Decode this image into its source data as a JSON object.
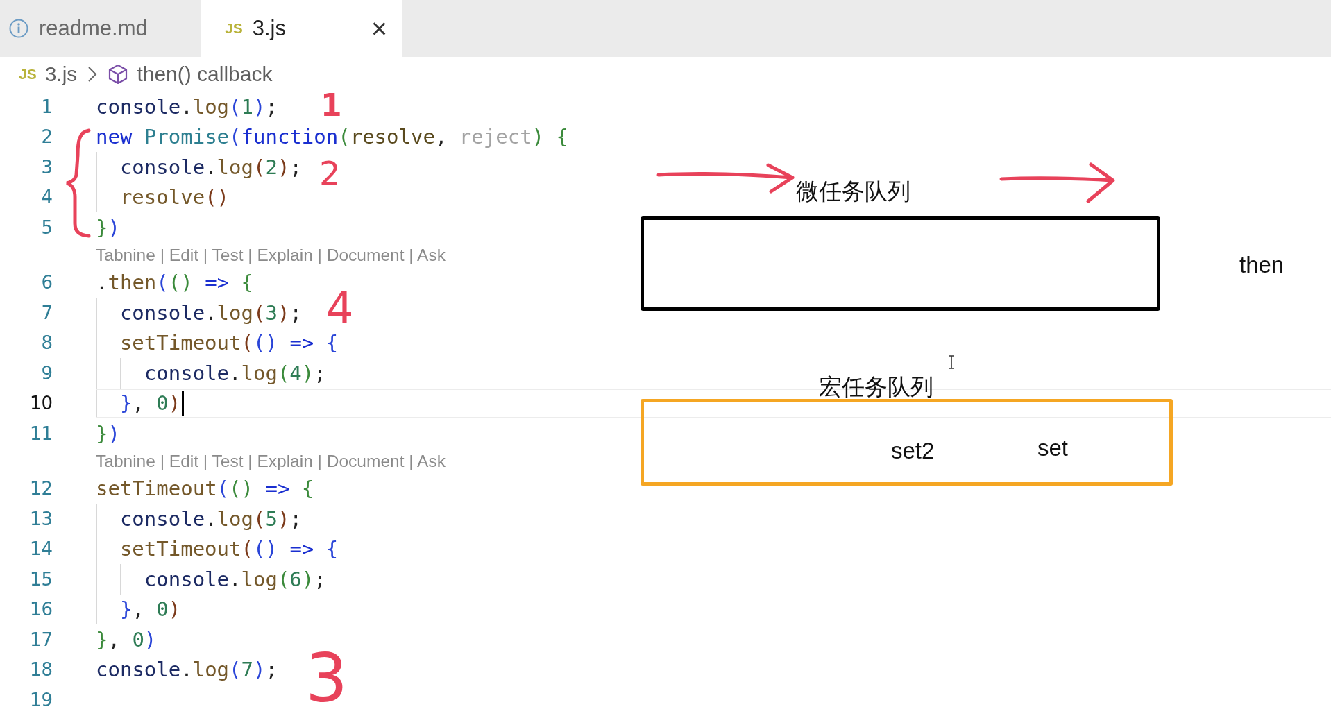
{
  "tabs": [
    {
      "kind": "doc",
      "label": "readme.md",
      "selected": false
    },
    {
      "kind": "script",
      "icon_text": "JS",
      "label": "3.js",
      "selected": true,
      "close": "×"
    }
  ],
  "breadcrumb": {
    "icon_text": "JS",
    "file": "3.js",
    "symbol": "then() callback"
  },
  "rows": [
    {
      "kind": "line",
      "number": "1",
      "current": false,
      "tokens": [
        {
          "text": "console",
          "color": "#1c2a63"
        },
        {
          "text": ".",
          "color": "#222222"
        },
        {
          "text": "log",
          "color": "#74582a"
        },
        {
          "text": "(",
          "color": "#2a45d8"
        },
        {
          "text": "1",
          "color": "#2e7c55"
        },
        {
          "text": ")",
          "color": "#2a45d8"
        },
        {
          "text": ";",
          "color": "#222222"
        }
      ]
    },
    {
      "kind": "line",
      "number": "2",
      "current": false,
      "tokens": [
        {
          "text": "new ",
          "color": "#1a2fd0"
        },
        {
          "text": "Promise",
          "color": "#2d7f90"
        },
        {
          "text": "(",
          "color": "#2a45d8"
        },
        {
          "text": "function",
          "color": "#1a2fd0"
        },
        {
          "text": "(",
          "color": "#3b8a3b"
        },
        {
          "text": "resolve",
          "color": "#5a4a1e"
        },
        {
          "text": ", ",
          "color": "#222222"
        },
        {
          "text": "reject",
          "color": "#a3a3a3"
        },
        {
          "text": ") ",
          "color": "#3b8a3b"
        },
        {
          "text": "{",
          "color": "#3b8a3b"
        }
      ],
      "children": [
        {
          "kind": "line",
          "number": "3",
          "current": false,
          "tokens": [
            {
              "text": "console",
              "color": "#1c2a63"
            },
            {
              "text": ".",
              "color": "#222222"
            },
            {
              "text": "log",
              "color": "#74582a"
            },
            {
              "text": "(",
              "color": "#7b3a1a"
            },
            {
              "text": "2",
              "color": "#2e7c55"
            },
            {
              "text": ")",
              "color": "#7b3a1a"
            },
            {
              "text": ";",
              "color": "#222222"
            }
          ]
        },
        {
          "kind": "line",
          "number": "4",
          "current": false,
          "tokens": [
            {
              "text": "resolve",
              "color": "#74582a"
            },
            {
              "text": "()",
              "color": "#7b3a1a"
            }
          ]
        }
      ]
    },
    {
      "kind": "line",
      "number": "5",
      "current": false,
      "tokens": [
        {
          "text": "}",
          "color": "#3b8a3b"
        },
        {
          "text": ")",
          "color": "#2a45d8"
        }
      ]
    },
    {
      "kind": "codelens",
      "text": "Tabnine | Edit | Test | Explain | Document | Ask"
    },
    {
      "kind": "line",
      "number": "6",
      "current": false,
      "tokens": [
        {
          "text": ".",
          "color": "#222222"
        },
        {
          "text": "then",
          "color": "#74582a"
        },
        {
          "text": "(",
          "color": "#2a45d8"
        },
        {
          "text": "() ",
          "color": "#3b8a3b"
        },
        {
          "text": "=> ",
          "color": "#1a2fd0"
        },
        {
          "text": "{",
          "color": "#3b8a3b"
        }
      ],
      "children": [
        {
          "kind": "line",
          "number": "7",
          "current": false,
          "tokens": [
            {
              "text": "console",
              "color": "#1c2a63"
            },
            {
              "text": ".",
              "color": "#222222"
            },
            {
              "text": "log",
              "color": "#74582a"
            },
            {
              "text": "(",
              "color": "#7b3a1a"
            },
            {
              "text": "3",
              "color": "#2e7c55"
            },
            {
              "text": ")",
              "color": "#7b3a1a"
            },
            {
              "text": ";",
              "color": "#222222"
            }
          ]
        },
        {
          "kind": "line",
          "number": "8",
          "current": false,
          "tokens": [
            {
              "text": "setTimeout",
              "color": "#74582a"
            },
            {
              "text": "(",
              "color": "#7b3a1a"
            },
            {
              "text": "() ",
              "color": "#2a45d8"
            },
            {
              "text": "=> ",
              "color": "#1a2fd0"
            },
            {
              "text": "{",
              "color": "#2a45d8"
            }
          ],
          "children": [
            {
              "kind": "line",
              "number": "9",
              "current": false,
              "tokens": [
                {
                  "text": "console",
                  "color": "#1c2a63"
                },
                {
                  "text": ".",
                  "color": "#222222"
                },
                {
                  "text": "log",
                  "color": "#74582a"
                },
                {
                  "text": "(",
                  "color": "#3b8a3b"
                },
                {
                  "text": "4",
                  "color": "#2e7c55"
                },
                {
                  "text": ")",
                  "color": "#3b8a3b"
                },
                {
                  "text": ";",
                  "color": "#222222"
                }
              ]
            }
          ]
        },
        {
          "kind": "line",
          "number": "10",
          "current": true,
          "tokens": [
            {
              "text": "}",
              "color": "#2a45d8"
            },
            {
              "text": ", ",
              "color": "#222222"
            },
            {
              "text": "0",
              "color": "#2e7c55"
            },
            {
              "text": ")",
              "color": "#7b3a1a"
            }
          ]
        }
      ]
    },
    {
      "kind": "line",
      "number": "11",
      "current": false,
      "tokens": [
        {
          "text": "}",
          "color": "#3b8a3b"
        },
        {
          "text": ")",
          "color": "#2a45d8"
        }
      ]
    },
    {
      "kind": "codelens",
      "text": "Tabnine | Edit | Test | Explain | Document | Ask"
    },
    {
      "kind": "line",
      "number": "12",
      "current": false,
      "tokens": [
        {
          "text": "setTimeout",
          "color": "#74582a"
        },
        {
          "text": "(",
          "color": "#2a45d8"
        },
        {
          "text": "() ",
          "color": "#3b8a3b"
        },
        {
          "text": "=> ",
          "color": "#1a2fd0"
        },
        {
          "text": "{",
          "color": "#3b8a3b"
        }
      ],
      "children": [
        {
          "kind": "line",
          "number": "13",
          "current": false,
          "tokens": [
            {
              "text": "console",
              "color": "#1c2a63"
            },
            {
              "text": ".",
              "color": "#222222"
            },
            {
              "text": "log",
              "color": "#74582a"
            },
            {
              "text": "(",
              "color": "#7b3a1a"
            },
            {
              "text": "5",
              "color": "#2e7c55"
            },
            {
              "text": ")",
              "color": "#7b3a1a"
            },
            {
              "text": ";",
              "color": "#222222"
            }
          ]
        },
        {
          "kind": "line",
          "number": "14",
          "current": false,
          "tokens": [
            {
              "text": "setTimeout",
              "color": "#74582a"
            },
            {
              "text": "(",
              "color": "#7b3a1a"
            },
            {
              "text": "() ",
              "color": "#2a45d8"
            },
            {
              "text": "=> ",
              "color": "#1a2fd0"
            },
            {
              "text": "{",
              "color": "#2a45d8"
            }
          ],
          "children": [
            {
              "kind": "line",
              "number": "15",
              "current": false,
              "tokens": [
                {
                  "text": "console",
                  "color": "#1c2a63"
                },
                {
                  "text": ".",
                  "color": "#222222"
                },
                {
                  "text": "log",
                  "color": "#74582a"
                },
                {
                  "text": "(",
                  "color": "#3b8a3b"
                },
                {
                  "text": "6",
                  "color": "#2e7c55"
                },
                {
                  "text": ")",
                  "color": "#3b8a3b"
                },
                {
                  "text": ";",
                  "color": "#222222"
                }
              ]
            }
          ]
        },
        {
          "kind": "line",
          "number": "16",
          "current": false,
          "tokens": [
            {
              "text": "}",
              "color": "#2a45d8"
            },
            {
              "text": ", ",
              "color": "#222222"
            },
            {
              "text": "0",
              "color": "#2e7c55"
            },
            {
              "text": ")",
              "color": "#7b3a1a"
            }
          ]
        }
      ]
    },
    {
      "kind": "line",
      "number": "17",
      "current": false,
      "tokens": [
        {
          "text": "}",
          "color": "#3b8a3b"
        },
        {
          "text": ", ",
          "color": "#222222"
        },
        {
          "text": "0",
          "color": "#2e7c55"
        },
        {
          "text": ")",
          "color": "#2a45d8"
        }
      ]
    },
    {
      "kind": "line",
      "number": "18",
      "current": false,
      "tokens": [
        {
          "text": "console",
          "color": "#1c2a63"
        },
        {
          "text": ".",
          "color": "#222222"
        },
        {
          "text": "log",
          "color": "#74582a"
        },
        {
          "text": "(",
          "color": "#2a45d8"
        },
        {
          "text": "7",
          "color": "#2e7c55"
        },
        {
          "text": ")",
          "color": "#2a45d8"
        },
        {
          "text": ";",
          "color": "#222222"
        }
      ]
    },
    {
      "kind": "line",
      "number": "19",
      "current": false
    }
  ],
  "diagram": {
    "queues": [
      {
        "label": "微任务队列",
        "color": "#000000"
      },
      {
        "label": "宏任务队列",
        "color": "#f5a623",
        "items": [
          "set2",
          "set"
        ]
      }
    ],
    "notes": [
      "then"
    ],
    "handwritten": [
      "1",
      "2",
      "4",
      "3"
    ]
  }
}
